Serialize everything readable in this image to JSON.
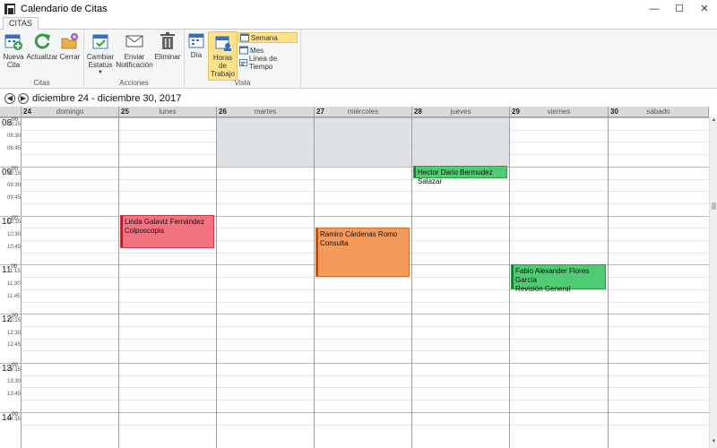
{
  "window": {
    "title": "Calendario de Citas",
    "min": "—",
    "max": "☐",
    "close": "✕"
  },
  "ribbon": {
    "tab": "CITAS",
    "groups": {
      "citas": {
        "label": "Citas",
        "nueva": [
          "Nueva",
          "Cita"
        ],
        "actualizar": "Actualizar",
        "cerrar": "Cerrar"
      },
      "acciones": {
        "label": "Acciones",
        "cambiar": [
          "Cambiar",
          "Estatus"
        ],
        "enviar": [
          "Enviar",
          "Notificación"
        ],
        "eliminar": "Eliminar"
      },
      "vista": {
        "label": "Vista",
        "dia": "Día",
        "horas": [
          "Horas de",
          "Trabajo"
        ],
        "semana": "Semana",
        "mes": "Mes",
        "linea": "Línea de Tiempo"
      }
    }
  },
  "nav": {
    "range": "diciembre 24 - diciembre 30, 2017",
    "prev": "◀",
    "next": "▶"
  },
  "days": [
    {
      "num": "24",
      "name": "domingo"
    },
    {
      "num": "25",
      "name": "lunes"
    },
    {
      "num": "26",
      "name": "martes"
    },
    {
      "num": "27",
      "name": "miércoles"
    },
    {
      "num": "28",
      "name": "jueves"
    },
    {
      "num": "29",
      "name": "viernes"
    },
    {
      "num": "30",
      "name": "sábado"
    }
  ],
  "hours": [
    {
      "h": "08",
      "m": "00",
      "q": [
        "08:15",
        "08:30",
        "08:45"
      ]
    },
    {
      "h": "09",
      "m": "00",
      "q": [
        "09:15",
        "09:30",
        "09:45"
      ]
    },
    {
      "h": "10",
      "m": "00",
      "q": [
        "10:15",
        "10:30",
        "10:45"
      ]
    },
    {
      "h": "11",
      "m": "00",
      "q": [
        "11:15",
        "11:30",
        "11:45"
      ]
    },
    {
      "h": "12",
      "m": "00",
      "q": [
        "12:15",
        "12:30",
        "12:45"
      ]
    },
    {
      "h": "13",
      "m": "00",
      "q": [
        "13:15",
        "13:30",
        "13:45"
      ]
    },
    {
      "h": "14",
      "m": "00",
      "q": [
        "14:15"
      ]
    }
  ],
  "appointments": [
    {
      "name": "Linda Galaviz Fernández",
      "detail": "Colposcopia",
      "color": "red"
    },
    {
      "name": "Ramiro Cárdenas Romo",
      "detail": "Consulta",
      "color": "orange"
    },
    {
      "name": "Hector Dario Bermudez Salazar",
      "detail": "",
      "color": "green"
    },
    {
      "name": "Fabio Alexander Flores García",
      "detail": "Revisión General",
      "color": "green"
    }
  ]
}
